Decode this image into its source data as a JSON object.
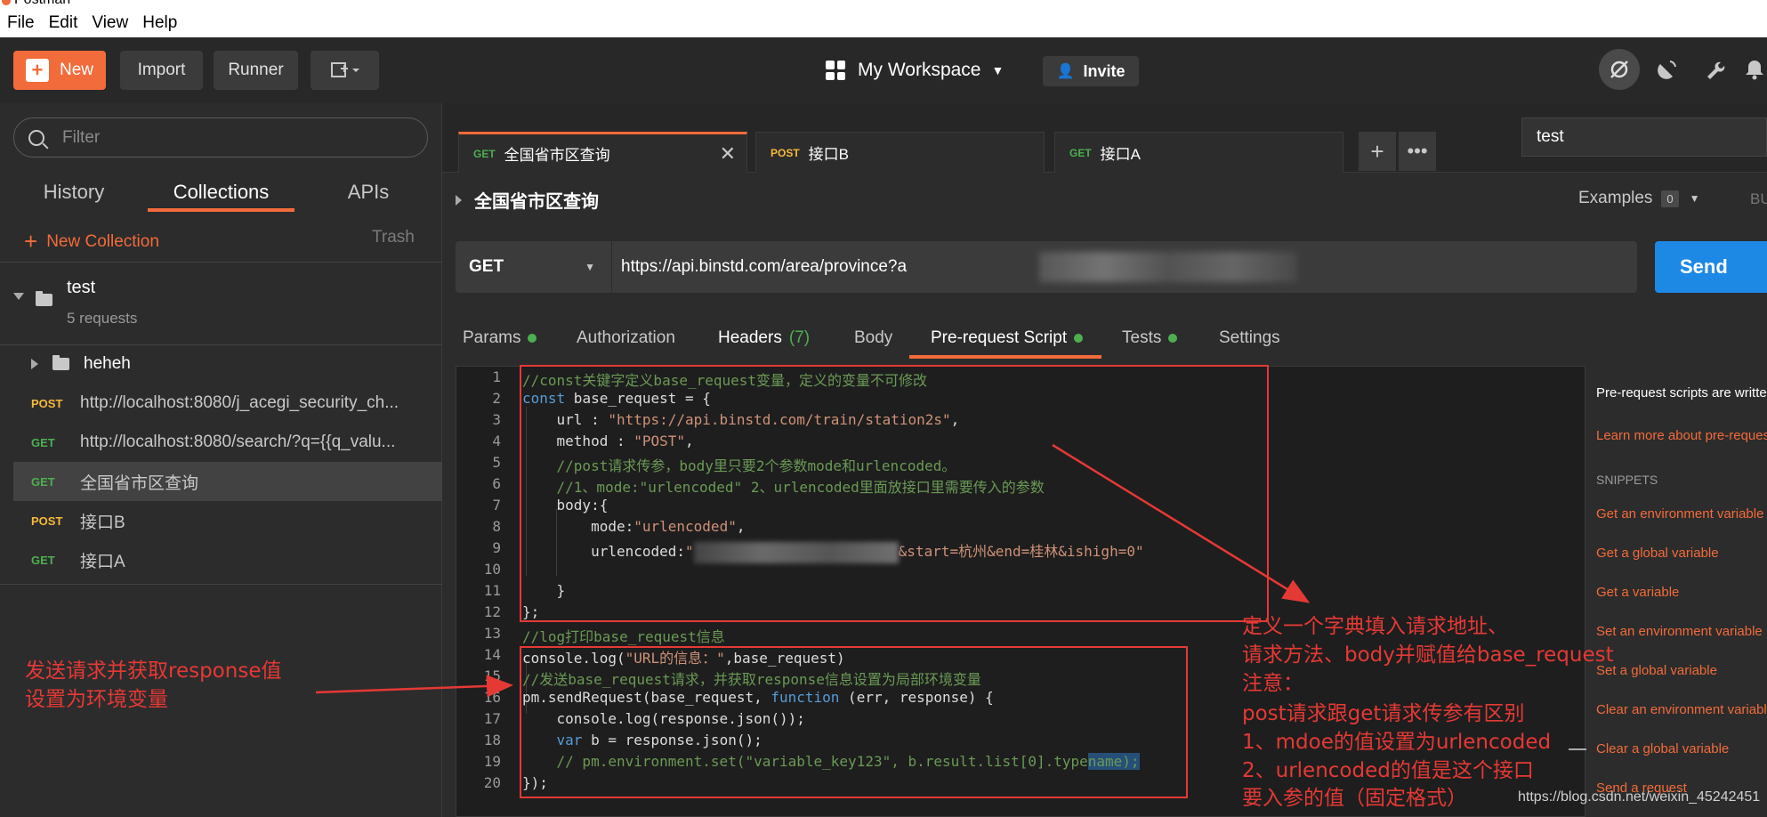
{
  "window": {
    "title": "Postman"
  },
  "menu": [
    "File",
    "Edit",
    "View",
    "Help"
  ],
  "header": {
    "new_label": "New",
    "import_label": "Import",
    "runner_label": "Runner",
    "workspace_label": "My Workspace",
    "invite_label": "Invite"
  },
  "sidebar": {
    "filter_placeholder": "Filter",
    "tabs": [
      "History",
      "Collections",
      "APIs"
    ],
    "new_collection_label": "New Collection",
    "trash_label": "Trash",
    "collection": {
      "name": "test",
      "meta": "5 requests"
    },
    "folder": {
      "name": "heheh"
    },
    "requests": [
      {
        "method": "POST",
        "name": "http://localhost:8080/j_acegi_security_ch..."
      },
      {
        "method": "GET",
        "name": "http://localhost:8080/search/?q={{q_valu..."
      },
      {
        "method": "GET",
        "name": "全国省市区查询"
      },
      {
        "method": "POST",
        "name": "接口B"
      },
      {
        "method": "GET",
        "name": "接口A"
      }
    ]
  },
  "tabs": [
    {
      "method": "GET",
      "name": "全国省市区查询"
    },
    {
      "method": "POST",
      "name": "接口B"
    },
    {
      "method": "GET",
      "name": "接口A"
    }
  ],
  "environment": "test",
  "request": {
    "title": "全国省市区查询",
    "examples_label": "Examples",
    "examples_count": "0",
    "build_label": "BU",
    "method": "GET",
    "url": "https://api.binstd.com/area/province?a",
    "send_label": "Send"
  },
  "request_tabs": {
    "params": "Params",
    "authorization": "Authorization",
    "headers": "Headers",
    "headers_count": "(7)",
    "body": "Body",
    "prerequest": "Pre-request Script",
    "tests": "Tests",
    "settings": "Settings"
  },
  "editor_lines": [
    {
      "n": "1",
      "t": "//const关键字定义base_request变量，定义的变量不可修改"
    },
    {
      "n": "2",
      "t": "const base_request = {"
    },
    {
      "n": "3",
      "t": "    url : \"https://api.binstd.com/train/station2s\","
    },
    {
      "n": "4",
      "t": "    method : \"POST\","
    },
    {
      "n": "5",
      "t": "    //post请求传参，body里只要2个参数mode和urlencoded。"
    },
    {
      "n": "6",
      "t": "    //1、mode:\"urlencoded\" 2、urlencoded里面放接口里需要传入的参数"
    },
    {
      "n": "7",
      "t": "    body:{"
    },
    {
      "n": "8",
      "t": "        mode:\"urlencoded\","
    },
    {
      "n": "9",
      "t": "        urlencoded:\""
    },
    {
      "n": "10",
      "t": ""
    },
    {
      "n": "11",
      "t": "    }"
    },
    {
      "n": "12",
      "t": "};"
    },
    {
      "n": "13",
      "t": "//log打印base_request信息"
    },
    {
      "n": "14",
      "t": "console.log(\"URL的信息：\",base_request)"
    },
    {
      "n": "15",
      "t": "//发送base_request请求，并获取response信息设置为局部环境变量"
    },
    {
      "n": "16",
      "t": "pm.sendRequest(base_request, function (err, response) {"
    },
    {
      "n": "17",
      "t": "    console.log(response.json());"
    },
    {
      "n": "18",
      "t": "    var b = response.json();"
    },
    {
      "n": "19",
      "t": "    // pm.environment.set(\"variable_key123\", b.result.list[0].typename);"
    },
    {
      "n": "20",
      "t": "});"
    }
  ],
  "editor_line9_tail": "&start=杭州&end=桂林&ishigh=0\"",
  "help": {
    "intro": "Pre-request scripts are written in JavaScript, and are run before the request is sent.",
    "learn_more": "Learn more about pre-request scripts",
    "snippets_heading": "SNIPPETS",
    "snippets": [
      "Get an environment variable",
      "Get a global variable",
      "Get a variable",
      "Set an environment variable",
      "Set a global variable",
      "Clear an environment variable",
      "Clear a global variable",
      "Send a request"
    ]
  },
  "annotations": {
    "left_line1": "发送请求并获取response值",
    "left_line2": "设置为环境变量",
    "right_lines": [
      "定义一个字典填入请求地址、",
      "请求方法、body并赋值给base_request",
      "注意：",
      "post请求跟get请求传参有区别",
      "1、mdoe的值设置为urlencoded",
      "2、urlencoded的值是这个接口",
      "要入参的值（固定格式）"
    ]
  },
  "watermark": "https://blog.csdn.net/weixin_45242451",
  "colors": {
    "accent": "#f26b3a",
    "send": "#1e88e5",
    "get": "#4caf50",
    "post": "#f6b93b",
    "annotation": "#e53935"
  }
}
